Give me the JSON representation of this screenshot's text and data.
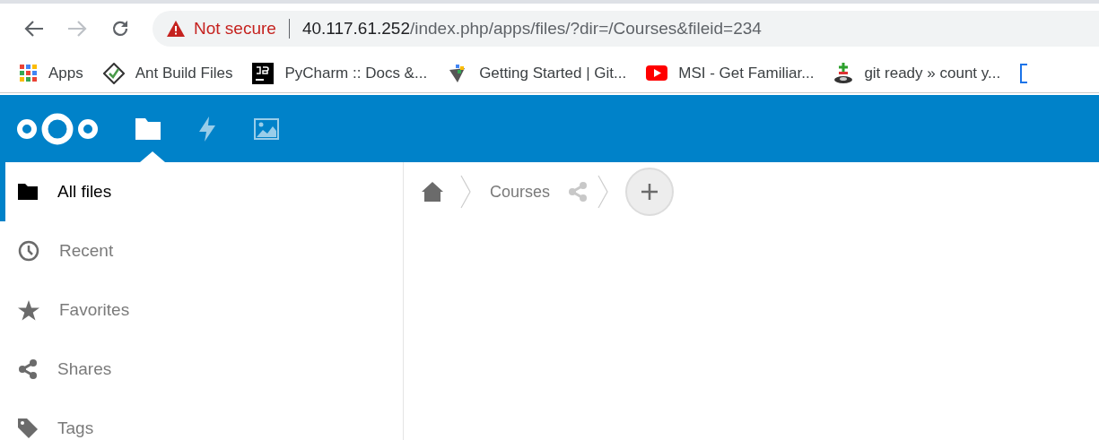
{
  "browser": {
    "security_label": "Not secure",
    "url_host": "40.117.61.252",
    "url_path": "/index.php/apps/files/?dir=/Courses&fileid=234"
  },
  "bookmarks": [
    {
      "kind": "apps",
      "label": "Apps"
    },
    {
      "kind": "ant",
      "label": "Ant Build Files"
    },
    {
      "kind": "jb",
      "label": "PyCharm :: Docs &..."
    },
    {
      "kind": "git",
      "label": "Getting Started | Git..."
    },
    {
      "kind": "youtube",
      "label": "MSI - Get Familiar..."
    },
    {
      "kind": "gitready",
      "label": "git ready » count y..."
    },
    {
      "kind": "edge"
    }
  ],
  "header_apps": [
    {
      "kind": "files",
      "selected": true
    },
    {
      "kind": "activity",
      "selected": false
    },
    {
      "kind": "gallery",
      "selected": false
    }
  ],
  "sidebar": {
    "items": [
      {
        "kind": "folder",
        "label": "All files",
        "selected": true
      },
      {
        "kind": "clock",
        "label": "Recent",
        "selected": false
      },
      {
        "kind": "star",
        "label": "Favorites",
        "selected": false
      },
      {
        "kind": "share",
        "label": "Shares",
        "selected": false
      },
      {
        "kind": "tag",
        "label": "Tags",
        "selected": false
      }
    ]
  },
  "breadcrumb": {
    "folder": "Courses"
  }
}
